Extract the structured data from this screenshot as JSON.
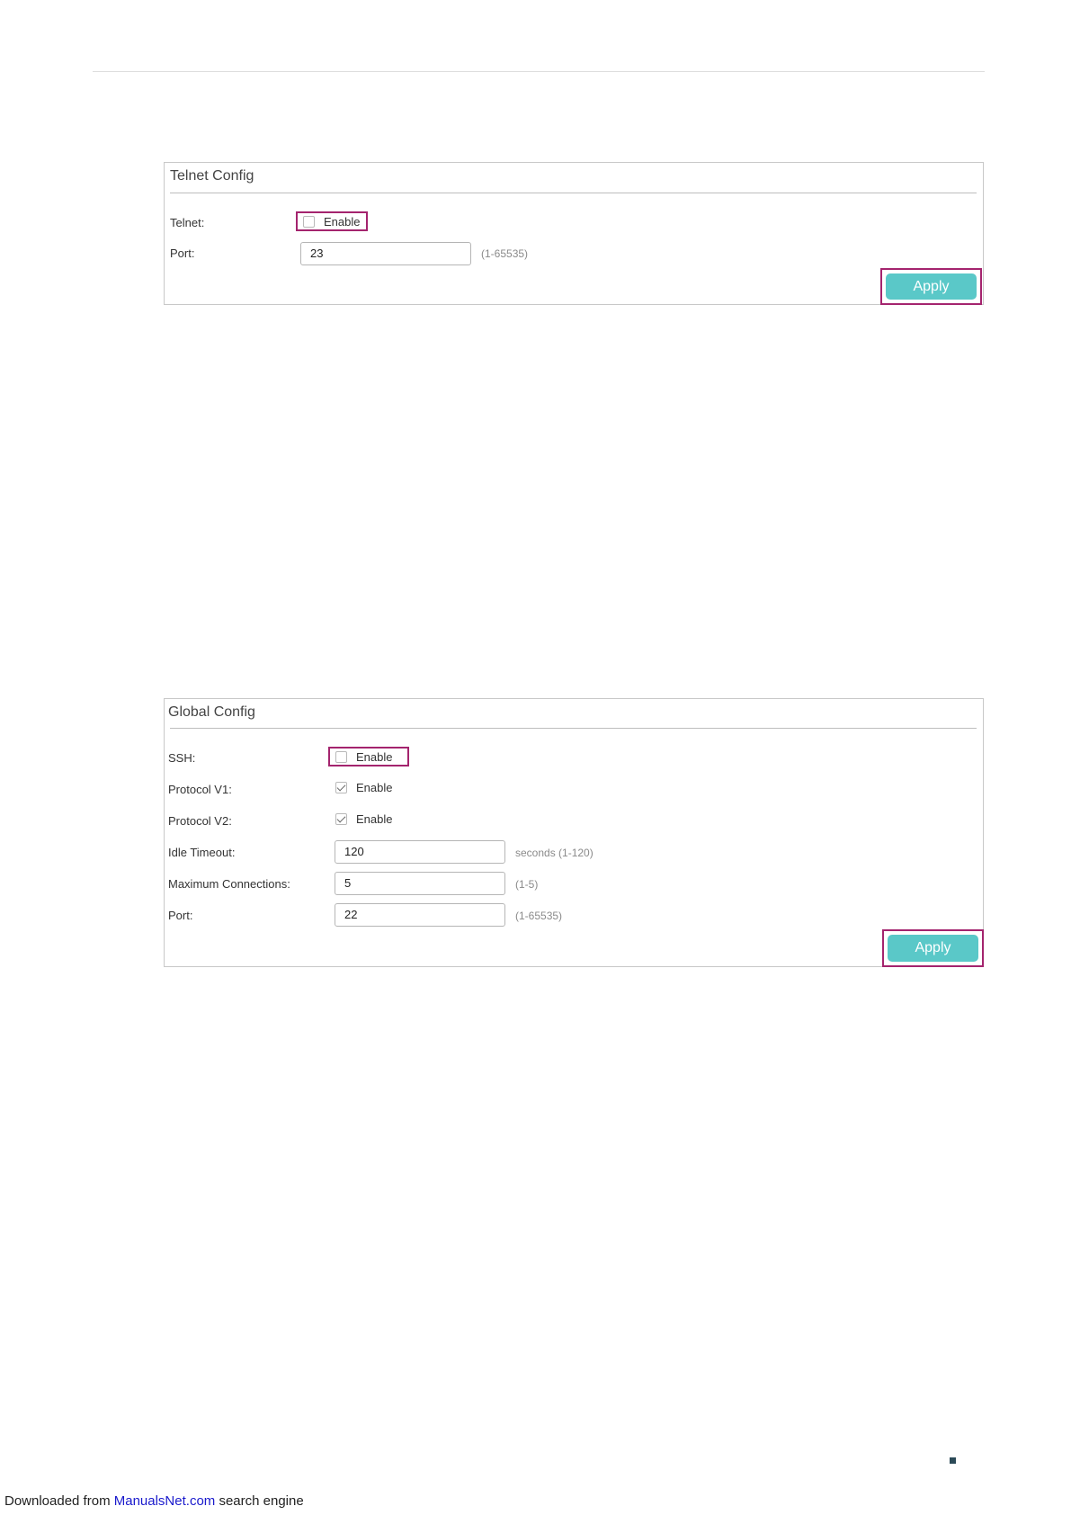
{
  "telnet_panel": {
    "title": "Telnet Config",
    "telnet_label": "Telnet:",
    "telnet_enable": {
      "label": "Enable",
      "checked": false
    },
    "port_label": "Port:",
    "port_value": "23",
    "port_hint": "(1-65535)",
    "apply_label": "Apply"
  },
  "ssh_panel": {
    "title": "Global Config",
    "ssh_label": "SSH:",
    "ssh_enable": {
      "label": "Enable",
      "checked": false
    },
    "protocol_v1_label": "Protocol V1:",
    "protocol_v1_enable": {
      "label": "Enable",
      "checked": true
    },
    "protocol_v2_label": "Protocol V2:",
    "protocol_v2_enable": {
      "label": "Enable",
      "checked": true
    },
    "idle_timeout_label": "Idle Timeout:",
    "idle_timeout_value": "120",
    "idle_timeout_hint": "seconds (1-120)",
    "max_connections_label": "Maximum Connections:",
    "max_connections_value": "5",
    "max_connections_hint": "(1-5)",
    "port_label": "Port:",
    "port_value": "22",
    "port_hint": "(1-65535)",
    "apply_label": "Apply"
  },
  "footer": {
    "prefix": "Downloaded from ",
    "link_text": "ManualsNet.com",
    "suffix": " search engine"
  },
  "colors": {
    "highlight_frame": "#a4246e",
    "apply_button": "#5ac8c8",
    "link": "#1a1acc"
  }
}
